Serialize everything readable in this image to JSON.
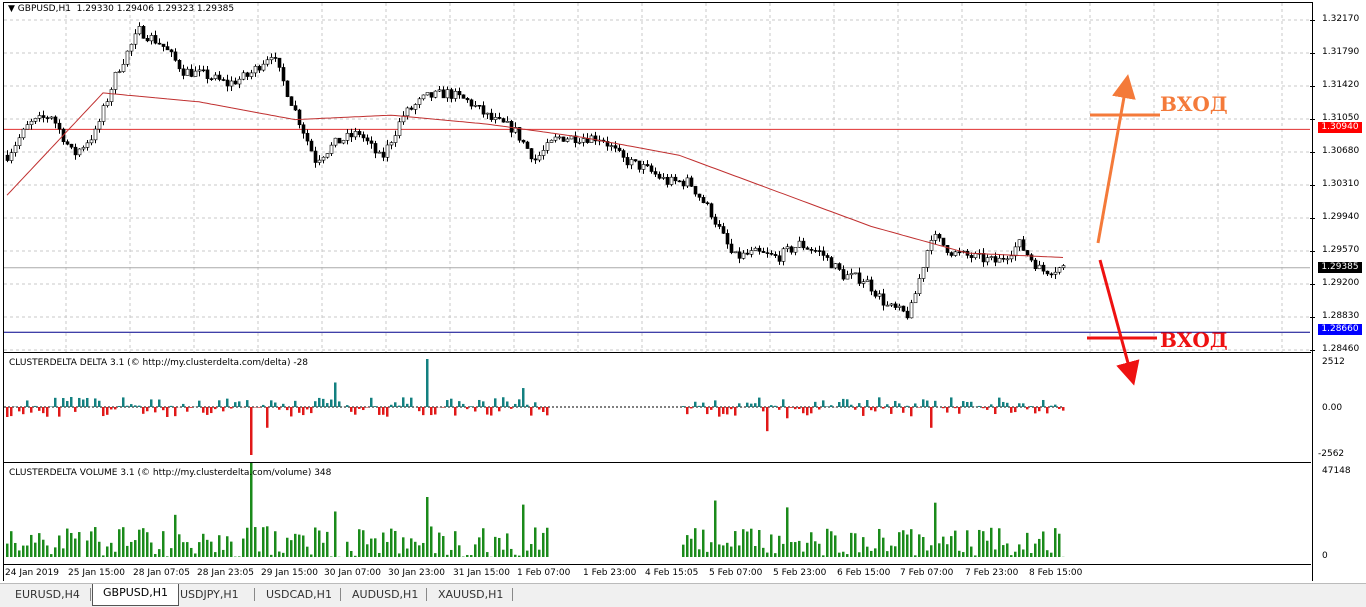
{
  "header": {
    "title": "GBPUSD,H1  1.29330 1.29406 1.29323 1.29385"
  },
  "price_axis": [
    "1.32170",
    "1.31790",
    "1.31420",
    "1.31050",
    "1.30680",
    "1.30310",
    "1.29940",
    "1.29570",
    "1.29200",
    "1.28830",
    "1.28460"
  ],
  "markers": {
    "red_level": "1.30940",
    "current": "1.29385",
    "blue_level": "1.28660",
    "red_color": "#ff0000",
    "blue_color": "#0000ff"
  },
  "annotations": {
    "up_label": "ВХОД",
    "down_label": "ВХОД",
    "up_color": "#f47a3a",
    "down_color": "#ee1111"
  },
  "delta_panel": {
    "title": "CLUSTERDELTA DELTA 3.1 (© http://my.clusterdelta.com/delta) -28",
    "axis": [
      "2512",
      "0.00",
      "-2562"
    ]
  },
  "volume_panel": {
    "title": "CLUSTERDELTA VOLUME 3.1 (© http://my.clusterdelta.com/volume) 348",
    "axis": [
      "47148",
      "0"
    ]
  },
  "time_axis": [
    "24 Jan 2019",
    "25 Jan 15:00",
    "28 Jan 07:05",
    "28 Jan 23:05",
    "29 Jan 15:00",
    "30 Jan 07:00",
    "30 Jan 23:00",
    "31 Jan 15:00",
    "1 Feb 07:00",
    "1 Feb 23:00",
    "4 Feb 15:05",
    "5 Feb 07:00",
    "5 Feb 23:00",
    "6 Feb 15:00",
    "7 Feb 07:00",
    "7 Feb 23:00",
    "8 Feb 15:00"
  ],
  "tabs": [
    {
      "label": "EURUSD,H4"
    },
    {
      "label": "GBPUSD,H1",
      "active": true
    },
    {
      "label": "USDJPY,H1"
    },
    {
      "label": "USDCAD,H1"
    },
    {
      "label": "AUDUSD,H1"
    },
    {
      "label": "XAUUSD,H1"
    }
  ],
  "chart_data": {
    "type": "candlestick",
    "symbol": "GBPUSD",
    "timeframe": "H1",
    "ylim": [
      1.2846,
      1.3217
    ],
    "close_path": [
      1.3065,
      1.31,
      1.311,
      1.3065,
      1.309,
      1.316,
      1.3205,
      1.319,
      1.316,
      1.3155,
      1.3145,
      1.3155,
      1.318,
      1.312,
      1.306,
      1.308,
      1.309,
      1.306,
      1.311,
      1.313,
      1.3135,
      1.3125,
      1.3105,
      1.3095,
      1.306,
      1.3085,
      1.3085,
      1.3085,
      1.306,
      1.305,
      1.3035,
      1.3035,
      1.3,
      1.295,
      1.2955,
      1.295,
      1.2965,
      1.2955,
      1.293,
      1.2925,
      1.2895,
      1.2885,
      1.2975,
      1.2955,
      1.295,
      1.2945,
      1.2965,
      1.2935,
      1.29385
    ],
    "ma_path": [
      1.302,
      1.3135,
      1.3125,
      1.3105,
      1.311,
      1.31,
      1.3085,
      1.3065,
      1.3025,
      1.2985,
      1.2955,
      1.295
    ]
  }
}
